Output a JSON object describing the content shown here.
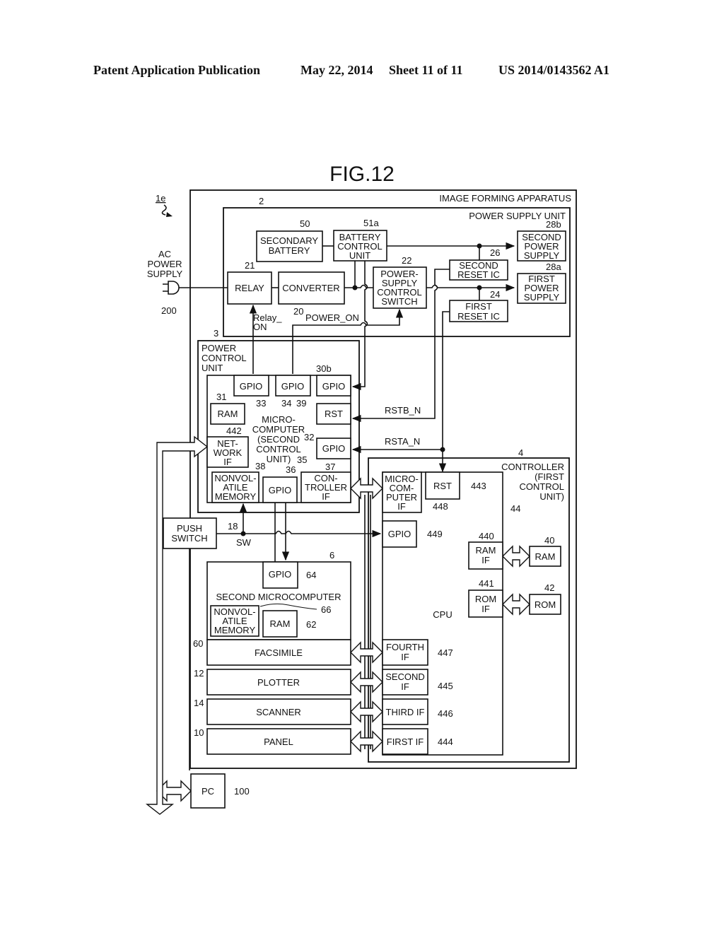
{
  "header": {
    "publication": "Patent Application Publication",
    "date": "May 22, 2014",
    "sheet": "Sheet 11 of 11",
    "number": "US 2014/0143562 A1"
  },
  "figure": {
    "title": "FIG.12",
    "system_ref": "1e",
    "image_forming_apparatus": "IMAGE FORMING APPARATUS",
    "power_supply_unit": {
      "label": "POWER SUPPLY UNIT",
      "ref": "2"
    },
    "ac_power_supply": {
      "lines": [
        "AC",
        "POWER",
        "SUPPLY"
      ],
      "ref": "200"
    },
    "secondary_battery": {
      "lines": [
        "SECONDARY",
        "BATTERY"
      ],
      "ref": "50"
    },
    "battery_control_unit": {
      "lines": [
        "BATTERY",
        "CONTROL",
        "UNIT"
      ],
      "ref": "51a"
    },
    "relay": {
      "label": "RELAY",
      "ref": "21"
    },
    "converter": {
      "label": "CONVERTER",
      "ref": "20"
    },
    "power_supply_control_switch": {
      "lines": [
        "POWER-",
        "SUPPLY",
        "CONTROL",
        "SWITCH"
      ],
      "ref": "22"
    },
    "second_reset_ic": {
      "lines": [
        "SECOND",
        "RESET IC"
      ],
      "ref": "26"
    },
    "first_reset_ic": {
      "lines": [
        "FIRST",
        "RESET IC"
      ],
      "ref": "24"
    },
    "second_power_supply": {
      "lines": [
        "SECOND",
        "POWER",
        "SUPPLY"
      ],
      "ref": "28b"
    },
    "first_power_supply": {
      "lines": [
        "FIRST",
        "POWER",
        "SUPPLY"
      ],
      "ref": "28a"
    },
    "signals": {
      "relay_on": [
        "Relay_",
        "ON"
      ],
      "power_on": "POWER_ON",
      "rstb_n": "RSTB_N",
      "rsta_n": "RSTA_N",
      "sw": "SW"
    },
    "power_control_unit": {
      "lines": [
        "POWER",
        "CONTROL",
        "UNIT"
      ],
      "ref": "3"
    },
    "microcomputer": {
      "lines": [
        "MICRO-",
        "COMPUTER",
        "(SECOND",
        "CONTROL",
        "UNIT)"
      ],
      "ref": "30b",
      "ref2": "32"
    },
    "gpio_33": {
      "label": "GPIO",
      "ref": "33"
    },
    "gpio_34": {
      "label": "GPIO",
      "ref": "34"
    },
    "gpio_39": {
      "label": "GPIO",
      "ref": "39"
    },
    "ram_31": {
      "label": "RAM",
      "ref": "31"
    },
    "rst_32": {
      "label": "RST"
    },
    "network_if": {
      "lines": [
        "NET-",
        "WORK",
        "IF"
      ],
      "ref": "442"
    },
    "gpio_35": {
      "label": "GPIO",
      "ref": "35"
    },
    "nonvolatile_38": {
      "lines": [
        "NONVOL-",
        "ATILE",
        "MEMORY"
      ],
      "ref": "38"
    },
    "gpio_36": {
      "label": "GPIO",
      "ref": "36"
    },
    "controller_if_37": {
      "lines": [
        "CON-",
        "TROLLER",
        "IF"
      ],
      "ref": "37"
    },
    "push_switch": {
      "lines": [
        "PUSH",
        "SWITCH"
      ],
      "ref": "18"
    },
    "second_microcomputer": {
      "label": "SECOND MICROCOMPUTER",
      "ref": "6"
    },
    "gpio_64": {
      "label": "GPIO",
      "ref": "64"
    },
    "nonvolatile_66": {
      "lines": [
        "NONVOL-",
        "ATILE",
        "MEMORY"
      ],
      "ref": "66"
    },
    "ram_62": {
      "label": "RAM",
      "ref": "62"
    },
    "facsimile": {
      "label": "FACSIMILE",
      "ref": "60"
    },
    "plotter": {
      "label": "PLOTTER",
      "ref": "12"
    },
    "scanner": {
      "label": "SCANNER",
      "ref": "14"
    },
    "panel": {
      "label": "PANEL",
      "ref": "10"
    },
    "controller": {
      "lines": [
        "CONTROLLER",
        "(FIRST",
        "CONTROL",
        "UNIT)"
      ],
      "ref": "4"
    },
    "cpu": {
      "label": "CPU",
      "ref": "44"
    },
    "microcomputer_if": {
      "lines": [
        "MICRO-",
        "COM-",
        "PUTER",
        "IF"
      ],
      "ref": "448"
    },
    "rst_443": {
      "label": "RST",
      "ref": "443"
    },
    "gpio_449": {
      "label": "GPIO",
      "ref": "449"
    },
    "ram_if": {
      "lines": [
        "RAM",
        "IF"
      ],
      "ref": "440"
    },
    "ram_40": {
      "label": "RAM",
      "ref": "40"
    },
    "rom_if": {
      "lines": [
        "ROM",
        "IF"
      ],
      "ref": "441"
    },
    "rom_42": {
      "label": "ROM",
      "ref": "42"
    },
    "fourth_if": {
      "lines": [
        "FOURTH",
        "IF"
      ],
      "ref": "447"
    },
    "second_if": {
      "lines": [
        "SECOND",
        "IF"
      ],
      "ref": "445"
    },
    "third_if": {
      "label": "THIRD IF",
      "ref": "446"
    },
    "first_if": {
      "label": "FIRST IF",
      "ref": "444"
    },
    "pc": {
      "label": "PC",
      "ref": "100"
    }
  }
}
